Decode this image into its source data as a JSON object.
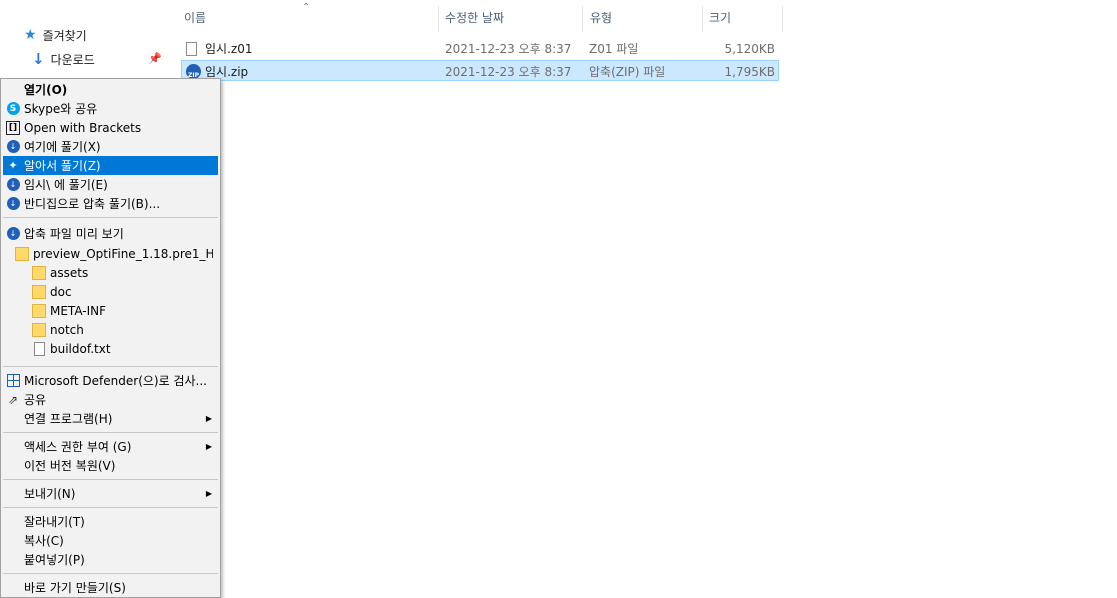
{
  "nav": {
    "quick_access": "즐겨찾기",
    "downloads": "다운로드"
  },
  "columns": {
    "name": "이름",
    "date": "수정한 날짜",
    "type": "유형",
    "size": "크기"
  },
  "files": [
    {
      "name": "임시.z01",
      "date": "2021-12-23 오후 8:37",
      "type": "Z01 파일",
      "size": "5,120KB"
    },
    {
      "name": "임시.zip",
      "date": "2021-12-23 오후 8:37",
      "type": "압축(ZIP) 파일",
      "size": "1,795KB"
    }
  ],
  "menu": {
    "open": "열기(O)",
    "skype_share": "Skype와 공유",
    "open_brackets": "Open with Brackets",
    "extract_here": "여기에 풀기(X)",
    "smart_extract": "알아서 풀기(Z)",
    "extract_to": "임시\\ 에 풀기(E)",
    "bandizip_extract": "반디집으로 압축 풀기(B)...",
    "preview": "압축 파일 미리 보기",
    "preview_root": "preview_OptiFine_1.18.pre1_H...",
    "preview_items": [
      "assets",
      "doc",
      "META-INF",
      "notch"
    ],
    "preview_file": "buildof.txt",
    "defender": "Microsoft Defender(으)로 검사...",
    "share": "공유",
    "open_with": "연결 프로그램(H)",
    "access": "액세스 권한 부여 (G)",
    "restore": "이전 버전 복원(V)",
    "send_to": "보내기(N)",
    "cut": "잘라내기(T)",
    "copy": "복사(C)",
    "paste": "붙여넣기(P)",
    "shortcut": "바로 가기 만들기(S)"
  },
  "colors": {
    "highlight": "#0078d7",
    "selection": "#cce8ff",
    "folder": "#ffd969"
  }
}
